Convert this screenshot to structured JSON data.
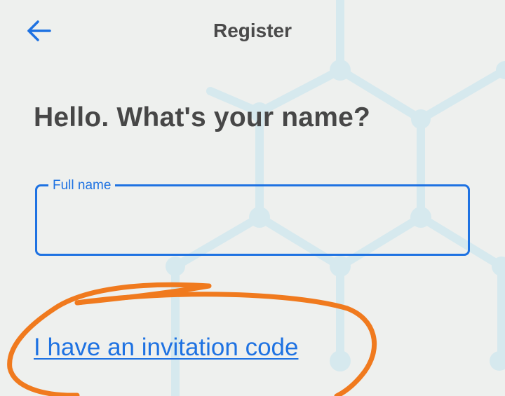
{
  "header": {
    "title": "Register",
    "back_icon": "arrow-left-icon"
  },
  "main": {
    "heading": "Hello. What's your name?",
    "full_name_field": {
      "label": "Full name",
      "value": ""
    },
    "invitation_link": "I have an invitation code"
  },
  "colors": {
    "accent": "#1e72e2",
    "text": "#474747",
    "background": "#eef0ee",
    "annotation": "#f07a1e"
  }
}
